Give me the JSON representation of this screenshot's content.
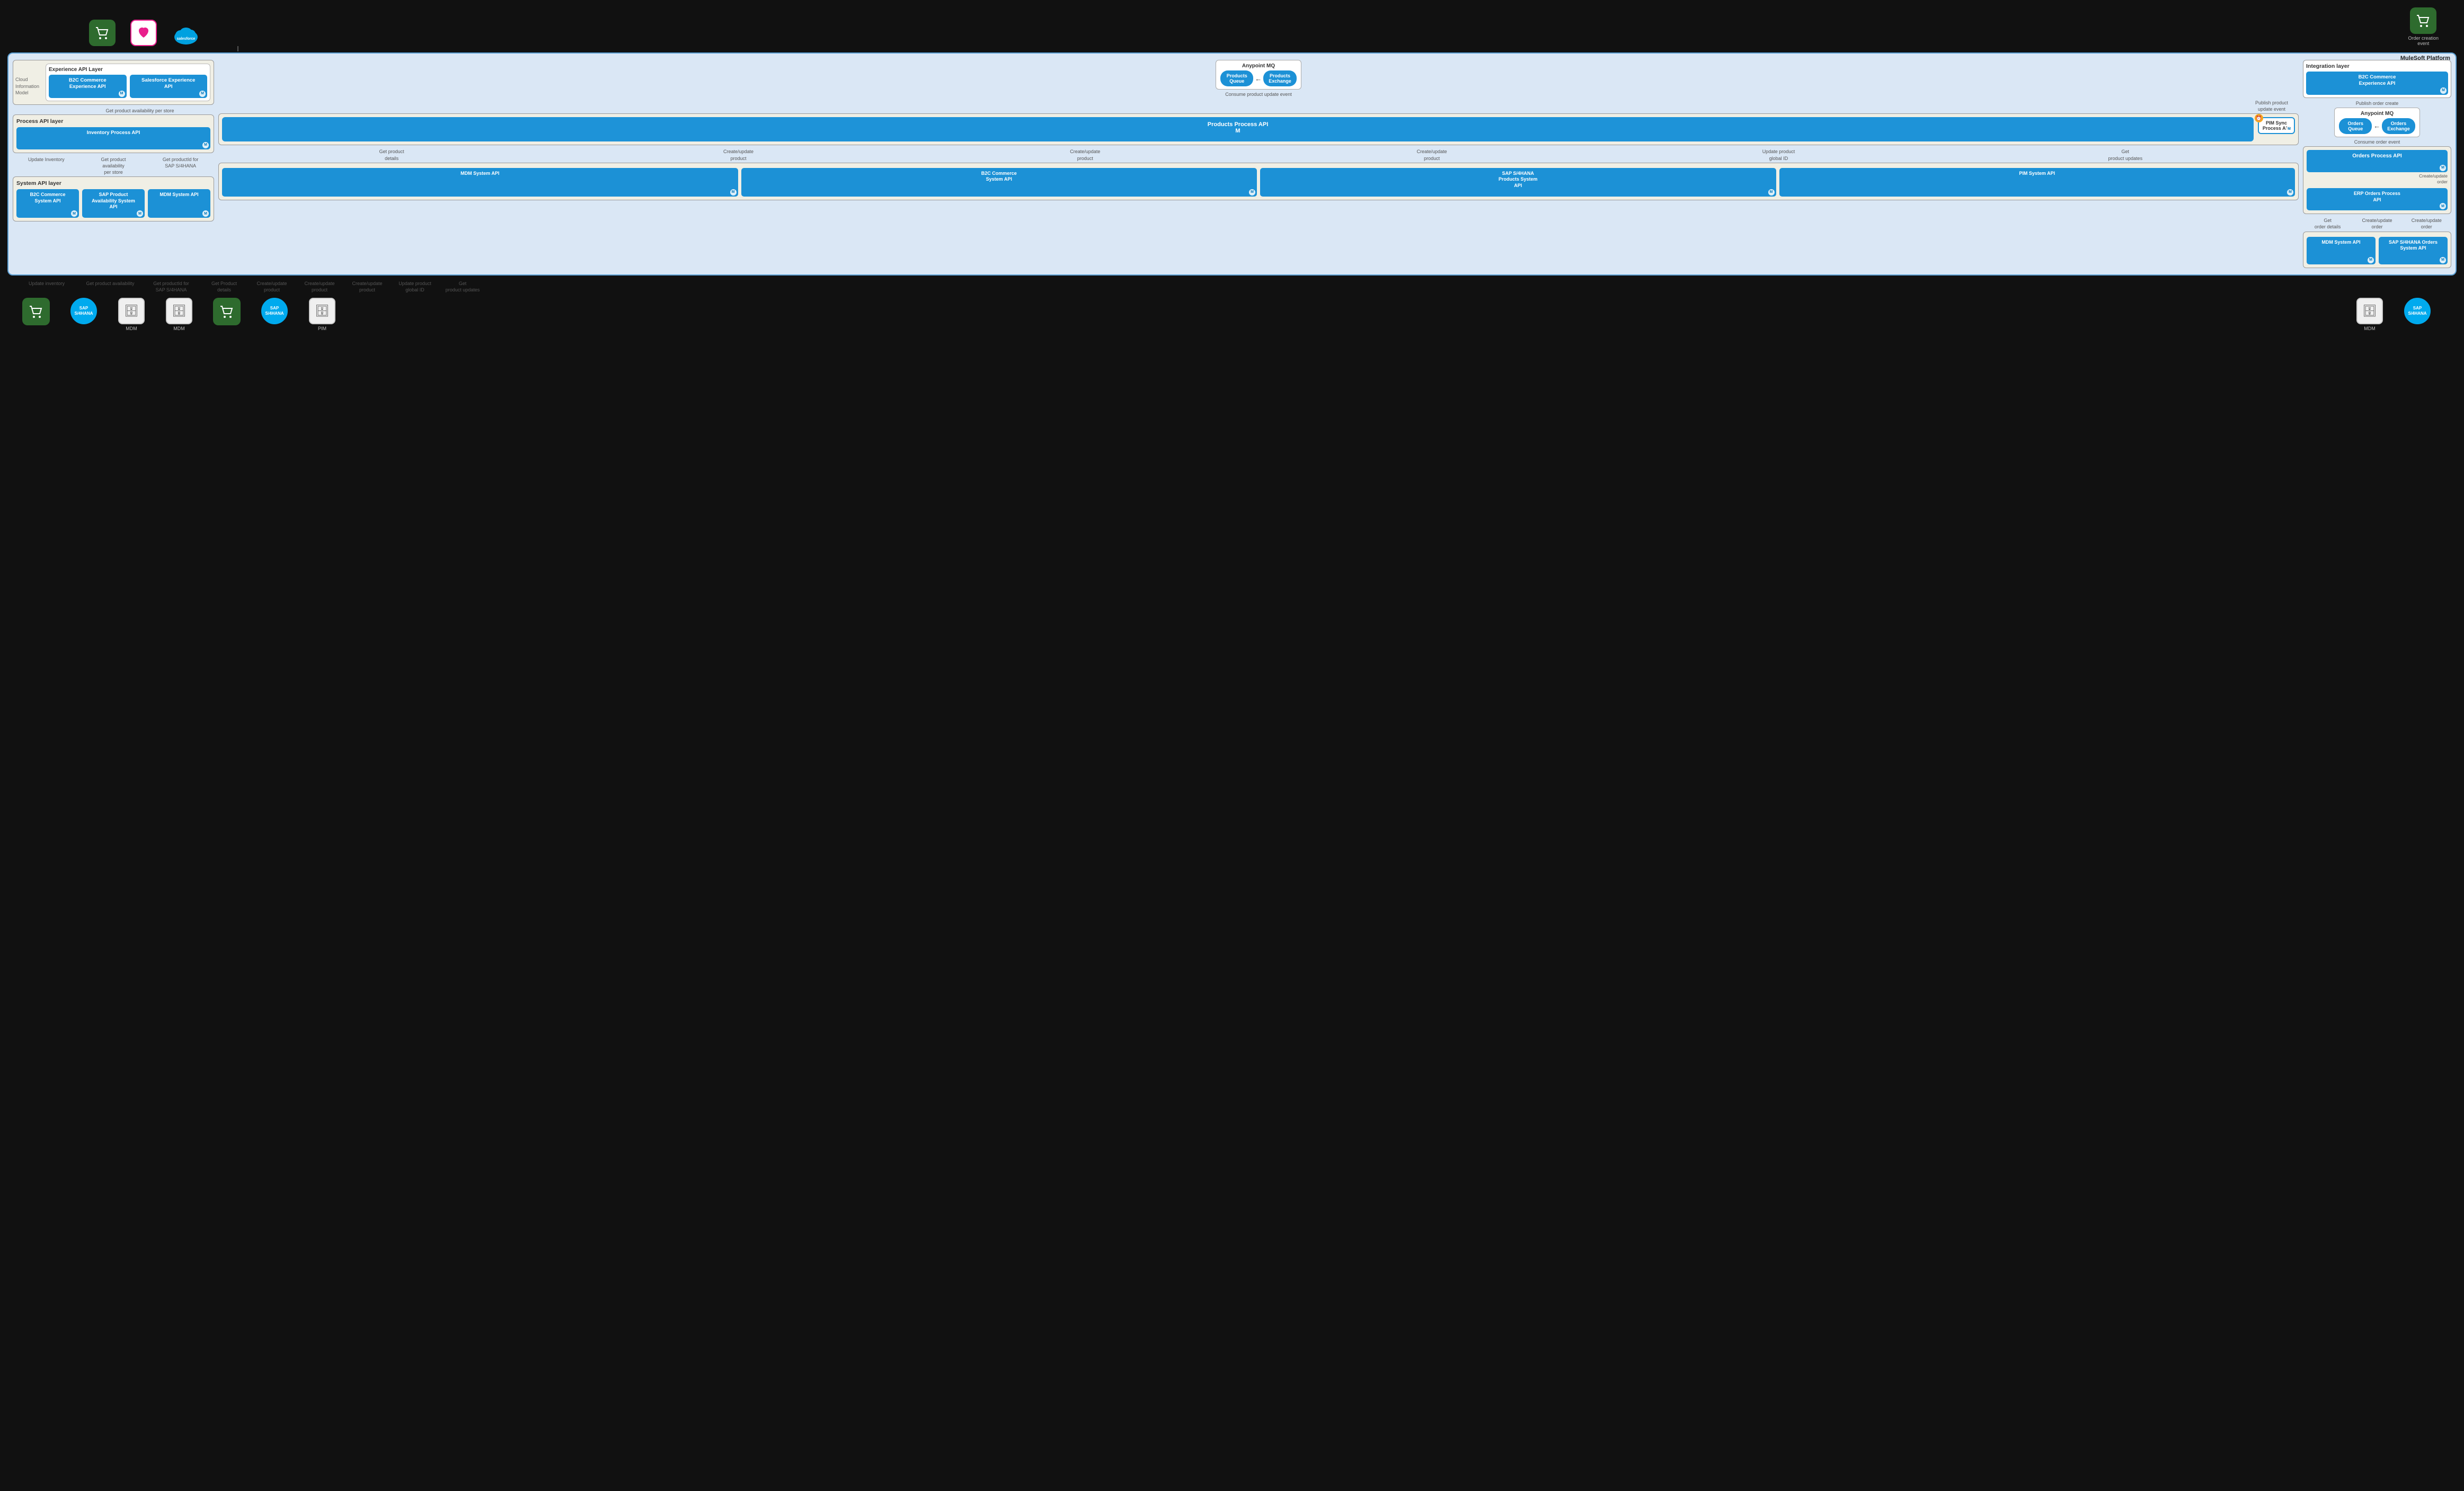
{
  "platform": {
    "title": "MuleSoft Platform"
  },
  "top_icons": [
    {
      "id": "cart1",
      "type": "green-cart",
      "label": ""
    },
    {
      "id": "wishlist",
      "type": "pink-heart",
      "label": ""
    },
    {
      "id": "salesforce",
      "type": "salesforce-cloud",
      "label": ""
    }
  ],
  "top_right_icon": {
    "id": "cart2",
    "type": "green-cart",
    "label": "Order creation\nevent"
  },
  "experience_api_layer": {
    "title": "Experience API Layer",
    "cloud_info": "Cloud\nInformation\nModel",
    "apis": [
      {
        "id": "b2c-exp",
        "label": "B2C Commerce\nExperience API"
      },
      {
        "id": "sf-exp",
        "label": "Salesforce Experience\nAPI"
      }
    ]
  },
  "anypoint_mq_center": {
    "title": "Anypoint MQ",
    "items": [
      {
        "id": "prod-queue",
        "label": "Products\nQueue"
      },
      {
        "id": "prod-exchange",
        "label": "Products\nExchange"
      }
    ],
    "consume_label": "Consume product\nupdate event"
  },
  "anypoint_mq_right": {
    "title": "Anypoint MQ",
    "items": [
      {
        "id": "orders-queue",
        "label": "Orders\nQueue"
      },
      {
        "id": "orders-exchange",
        "label": "Orders\nExchange"
      }
    ],
    "consume_label": "Consume order event"
  },
  "integration_layer": {
    "title": "Integration layer",
    "apis": [
      {
        "id": "b2c-int",
        "label": "B2C Commerce\nExperience API"
      }
    ],
    "publish_label": "Publish order create"
  },
  "process_api_layer": {
    "title": "Process API layer",
    "inventory_api": "Inventory Process API",
    "products_api": "Products  Process API",
    "orders_api": "Orders Process API",
    "erp_orders_api": "ERP Orders Process\nAPI",
    "pim_sync_api": "PIM Sync\nProcess API"
  },
  "annotations_mid": {
    "update_inventory": "Update Inventory",
    "get_prod_avail_per_store": "Get product availability per\nstore",
    "get_prod_avail": "Get product availability\nper store",
    "get_productid": "Get productId for\nSAP S/4HANA",
    "get_product_details": "Get product\ndetails",
    "create_update_product1": "Create/update\nproduct",
    "create_update_product2": "Create/update\nproduct",
    "create_update_product3": "Create/update\nproduct",
    "update_product_global_id": "Update product\nglobal ID",
    "get_product_updates": "Get\nproduct updates",
    "get_order_details": "Get\norder details",
    "create_update_order1": "Create/update\norder",
    "create_update_order2": "Create/update\norder",
    "publish_product_update": "Publish product\nupdate event"
  },
  "system_api_layer": {
    "title": "System API layer",
    "left_apis": [
      {
        "id": "b2c-sys",
        "label": "B2C Commerce\nSystem API"
      },
      {
        "id": "sap-avail",
        "label": "SAP Product\nAvailability System\nAPI"
      },
      {
        "id": "mdm-sys1",
        "label": "MDM System API"
      }
    ],
    "center_apis": [
      {
        "id": "mdm-sys2",
        "label": "MDM System API"
      },
      {
        "id": "b2c-sys2",
        "label": "B2C Commerce\nSystem API"
      },
      {
        "id": "sap-prod",
        "label": "SAP S/4HANA\nProducts System\nAPI"
      },
      {
        "id": "pim-sys",
        "label": "PIM System API"
      }
    ],
    "right_apis": [
      {
        "id": "mdm-sys3",
        "label": "MDM System API"
      },
      {
        "id": "sap-orders",
        "label": "SAP S/4HANA Orders\nSystem API"
      }
    ]
  },
  "bottom_icons": [
    {
      "id": "b-cart1",
      "type": "green-cart",
      "sublabel": "Update inventory",
      "label": ""
    },
    {
      "id": "b-sap1",
      "type": "sap",
      "sublabel": "Get product availability",
      "label": "SAP\nS/4HANA"
    },
    {
      "id": "b-mdm1",
      "type": "db",
      "sublabel": "Get productId for\nSAP S/4HANA",
      "label": "MDM"
    },
    {
      "id": "b-mdm2",
      "type": "db",
      "sublabel": "Get Product\ndetails",
      "label": "MDM"
    },
    {
      "id": "b-cart2",
      "type": "green-cart",
      "sublabel": "Create/update\nproduct",
      "label": ""
    },
    {
      "id": "b-sap2",
      "type": "sap",
      "sublabel": "Create/update\nproduct",
      "label": "SAP\nS/4HANA"
    },
    {
      "id": "b-pim",
      "type": "db",
      "sublabel": "Get\nproduct updates",
      "label": "PIM"
    },
    {
      "id": "b-mdm3",
      "type": "db",
      "sublabel": "",
      "label": "MDM"
    },
    {
      "id": "b-sap3",
      "type": "sap",
      "sublabel": "",
      "label": "SAP\nS/4HANA"
    }
  ],
  "bottom_annotations": [
    "Update inventory",
    "Get product availability",
    "Get productId for\nSAP S/4HANA",
    "Get Product\ndetails",
    "Create/update\nproduct",
    "Create/update\nproduct",
    "Create/update\nproduct",
    "Update product\nglobal ID",
    "Get\nproduct updates"
  ]
}
